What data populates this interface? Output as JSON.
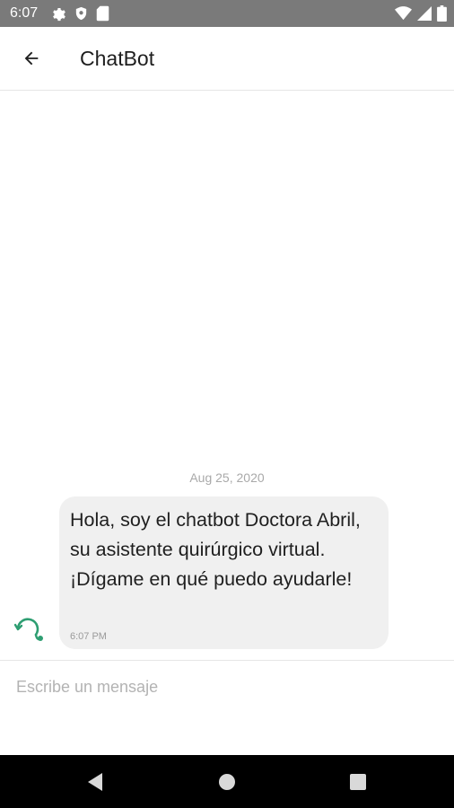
{
  "status_bar": {
    "time": "6:07",
    "left_icons": [
      "settings-icon",
      "shield-icon",
      "sd-card-icon"
    ],
    "right_icons": [
      "wifi-icon",
      "cell-signal-icon",
      "battery-icon"
    ],
    "background": "#7a7a7a"
  },
  "app_bar": {
    "back_icon": "arrow-left-icon",
    "title": "ChatBot"
  },
  "chat": {
    "date_separator": "Aug 25, 2020",
    "messages": [
      {
        "sender": "bot",
        "avatar_icon": "stethoscope-icon",
        "text": "Hola, soy el chatbot Doctora Abril, su asistente quirúrgico virtual. ¡Dígame en qué puedo ayudarle!",
        "time": "6:07 PM"
      }
    ],
    "accent_color": "#2e9e72"
  },
  "composer": {
    "placeholder": "Escribe un mensaje",
    "value": ""
  },
  "nav_bar": {
    "buttons": [
      "back-triangle-icon",
      "home-circle-icon",
      "recents-square-icon"
    ]
  }
}
